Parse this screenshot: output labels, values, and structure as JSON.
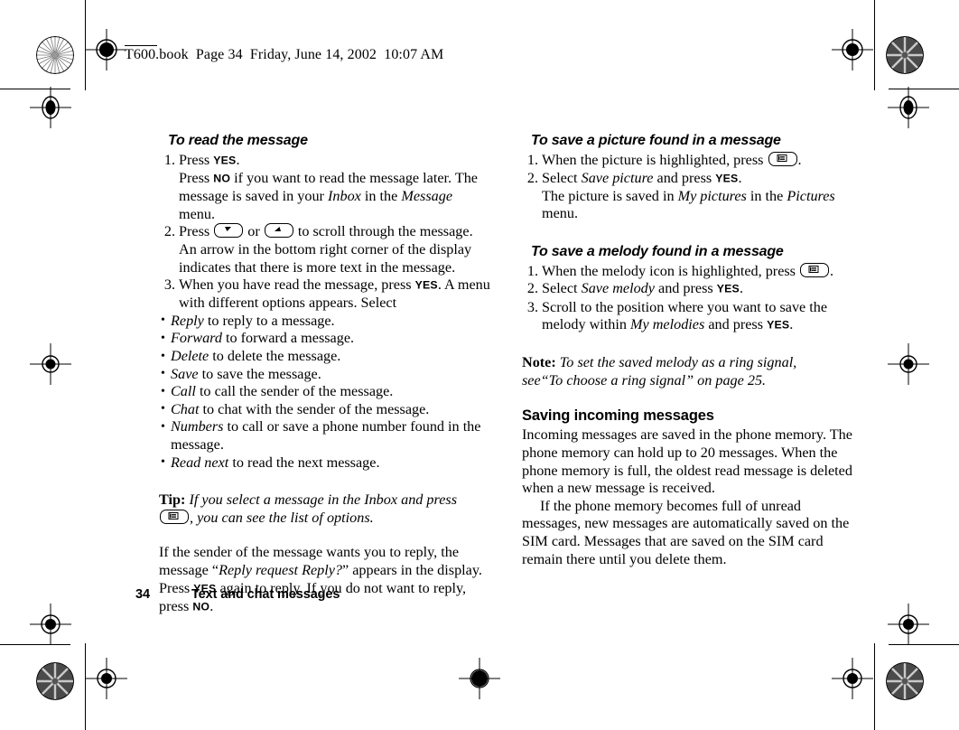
{
  "slug": {
    "text": "T600.book  Page 34  Friday, June 14, 2002  10:07 AM"
  },
  "footer": {
    "page_number": "34",
    "chapter_title": "Text and chat messages"
  },
  "icons": {
    "scroll_down": "scroll-down-key-icon",
    "scroll_up": "scroll-up-key-icon",
    "menu_key": "menu-key-icon",
    "registration_mark": "registration-mark-icon",
    "color_target": "color-calibration-target-icon"
  },
  "left_column": {
    "heading": "To read the message",
    "steps": [
      {
        "lines": [
          {
            "pre": "Press ",
            "key": "YES",
            "post": "."
          },
          {
            "pre": "Press ",
            "key": "NO",
            "post": " if you want to read the message later. The message is saved in your ",
            "em1": "Inbox",
            "mid": " in the ",
            "em2": "Message",
            "tail": " menu."
          }
        ]
      },
      {
        "lines": [
          {
            "pre": "Press ",
            "icon1": "scroll-down-key-icon",
            "mid": " or ",
            "icon2": "scroll-up-key-icon",
            "post": " to scroll through the message. An arrow in the bottom right corner of the display indicates that there is more text in the message."
          }
        ]
      },
      {
        "lines": [
          {
            "pre": "When you have read the message, press ",
            "key": "YES",
            "post": ". A menu with different options appears. Select"
          }
        ]
      }
    ],
    "bullets": [
      {
        "term": "Reply",
        "text": " to reply to a message."
      },
      {
        "term": "Forward",
        "text": " to forward a message."
      },
      {
        "term": "Delete",
        "text": " to delete the message."
      },
      {
        "term": "Save",
        "text": " to save the message."
      },
      {
        "term": "Call",
        "text": " to call the sender of the message."
      },
      {
        "term": "Chat",
        "text": " to chat with the sender of the message."
      },
      {
        "term": "Numbers",
        "text": " to call or save a phone number found in the message."
      },
      {
        "term": "Read next",
        "text": " to read the next message."
      }
    ],
    "tip": {
      "label": "Tip:",
      "text_before_icon": " If you select a message in the Inbox and press ",
      "icon": "menu-key-icon",
      "text_after_icon": ", you can see the list of options."
    },
    "closing_paragraph": {
      "part1": "If the sender of the message wants you to reply, the message “",
      "em": "Reply request Reply?",
      "part2": "” appears in the display. Press ",
      "key1": "YES",
      "part3": " again to reply. If you do not want to reply, press ",
      "key2": "NO",
      "part4": "."
    }
  },
  "right_column": {
    "picture_section": {
      "heading": "To save a picture found in a message",
      "steps": [
        {
          "pre": "When the picture is highlighted, press ",
          "icon": "menu-key-icon",
          "post": "."
        },
        {
          "pre": "Select ",
          "em": "Save picture",
          "mid": " and press ",
          "key": "YES",
          "post": ".",
          "extra_pre": "The picture is saved in ",
          "extra_em1": "My pictures",
          "extra_mid": " in the ",
          "extra_em2": "Pictures",
          "extra_post": " menu."
        }
      ]
    },
    "melody_section": {
      "heading": "To save a melody found in a message",
      "steps": [
        {
          "pre": "When the melody icon is highlighted, press ",
          "icon": "menu-key-icon",
          "post": "."
        },
        {
          "pre": "Select ",
          "em": "Save melody",
          "mid": " and press ",
          "key": "YES",
          "post": "."
        },
        {
          "pre": "Scroll to the position where you want to save the melody within ",
          "em": "My melodies",
          "mid": " and press ",
          "key": "YES",
          "post": "."
        }
      ]
    },
    "note": {
      "label": "Note:",
      "line1": " To set the saved melody as a ring signal,",
      "line2": "see“To choose a ring signal” on page 25."
    },
    "saving_section": {
      "heading": "Saving incoming messages",
      "paragraph1": "Incoming messages are saved in the phone memory. The phone memory can hold up to 20 messages. When the phone memory is full, the oldest read message is deleted when a new message is received.",
      "paragraph2": "If the phone memory becomes full of unread messages, new messages are automatically saved on the SIM card. Messages that are saved on the SIM card remain there until you delete them."
    }
  }
}
